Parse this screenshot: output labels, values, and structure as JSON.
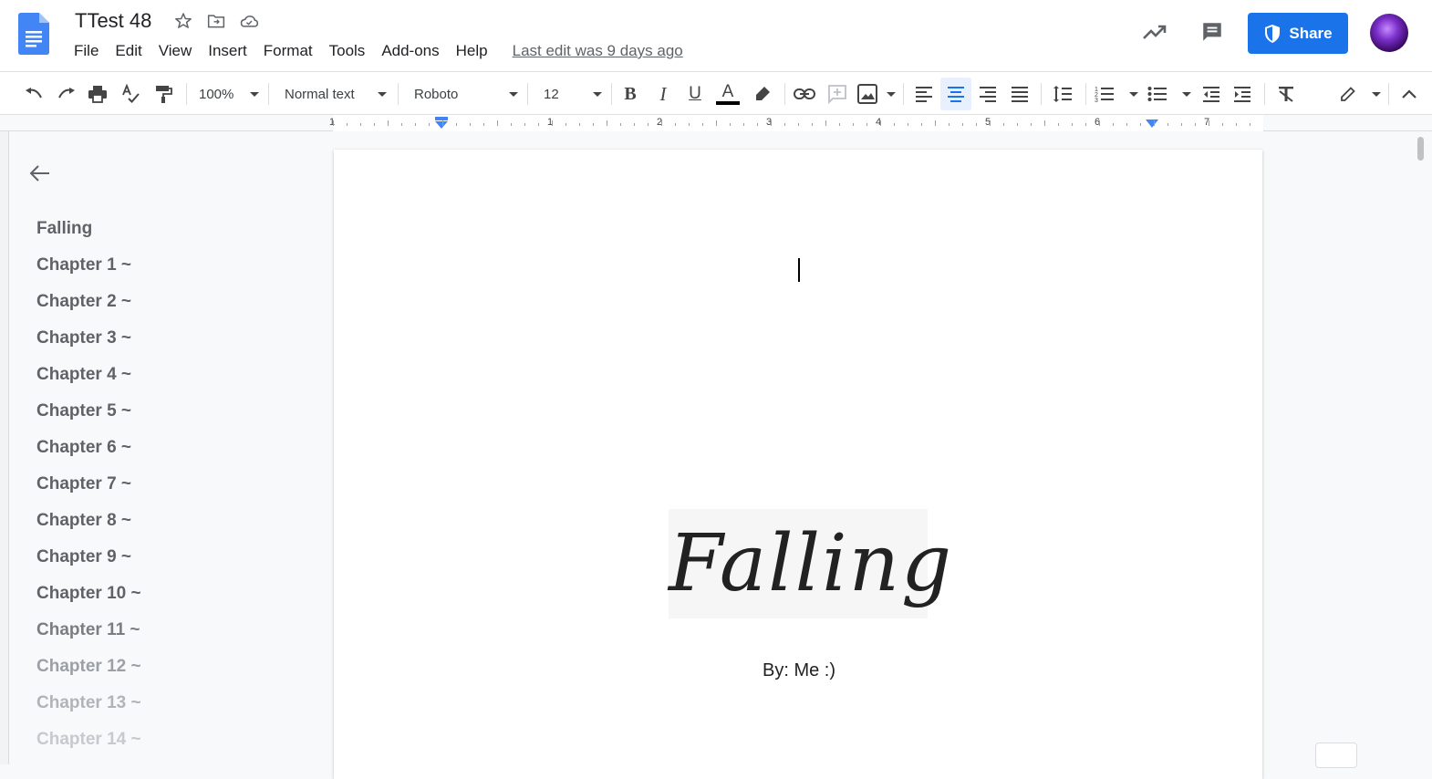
{
  "header": {
    "title": "TTest 48",
    "menu": [
      "File",
      "Edit",
      "View",
      "Insert",
      "Format",
      "Tools",
      "Add-ons",
      "Help"
    ],
    "last_edit": "Last edit was 9 days ago",
    "share_label": "Share"
  },
  "toolbar": {
    "zoom": "100%",
    "style": "Normal text",
    "font": "Roboto",
    "size": "12"
  },
  "ruler": {
    "labels": [
      "1",
      "1",
      "2",
      "3",
      "4",
      "5",
      "6",
      "7"
    ]
  },
  "outline": {
    "items": [
      {
        "label": "Falling",
        "color": "#5f6368"
      },
      {
        "label": "Chapter 1 ~",
        "color": "#5f6368"
      },
      {
        "label": "Chapter 2 ~",
        "color": "#5f6368"
      },
      {
        "label": "Chapter 3 ~",
        "color": "#5f6368"
      },
      {
        "label": "Chapter 4 ~",
        "color": "#5f6368"
      },
      {
        "label": "Chapter 5 ~",
        "color": "#5f6368"
      },
      {
        "label": "Chapter 6 ~",
        "color": "#5f6368"
      },
      {
        "label": "Chapter 7 ~",
        "color": "#5f6368"
      },
      {
        "label": "Chapter 8 ~",
        "color": "#5f6368"
      },
      {
        "label": "Chapter 9 ~",
        "color": "#5f6368"
      },
      {
        "label": "Chapter 10 ~",
        "color": "#5f6368"
      },
      {
        "label": "Chapter 11 ~",
        "color": "#7a7d82"
      },
      {
        "label": "Chapter 12 ~",
        "color": "#9aa0a6"
      },
      {
        "label": "Chapter 13 ~",
        "color": "#b0b4b9"
      },
      {
        "label": "Chapter 14 ~",
        "color": "#c6c9cd"
      }
    ]
  },
  "document": {
    "title_art": "Falling",
    "byline": "By: Me :)"
  },
  "colors": {
    "accent": "#1a73e8",
    "docs_blue": "#4285f4"
  }
}
